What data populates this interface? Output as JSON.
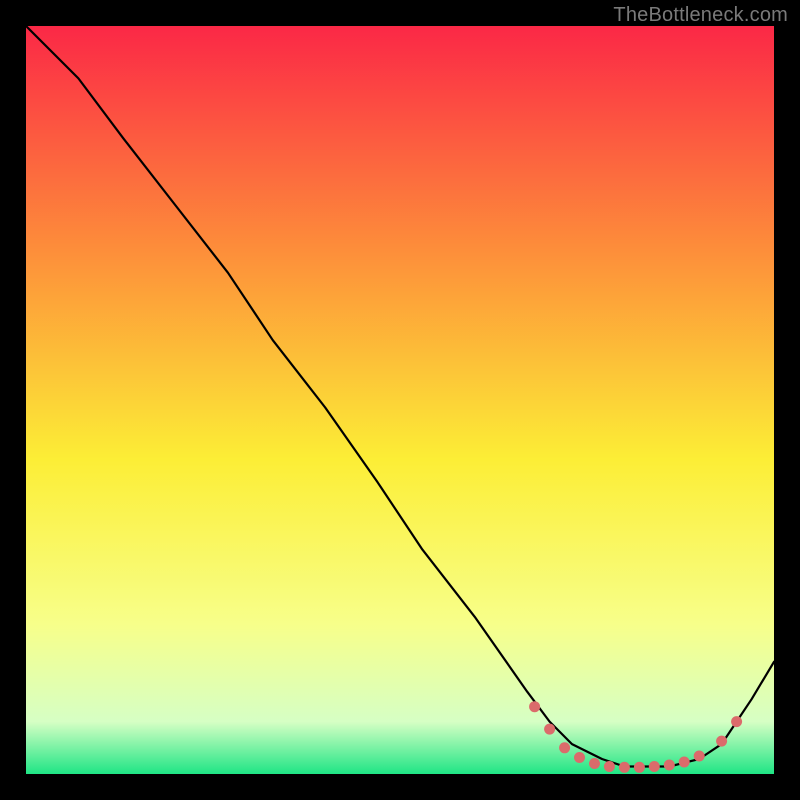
{
  "watermark": "TheBottleneck.com",
  "colors": {
    "gradient_top": "#fb2846",
    "gradient_mid_top": "#fd8e3a",
    "gradient_mid": "#fcee36",
    "gradient_mid_low": "#f7ff8a",
    "gradient_low": "#d6ffc4",
    "gradient_bottom": "#1fe585",
    "curve": "#000000",
    "dot": "#db6b6b",
    "background": "#000000"
  },
  "chart_data": {
    "type": "line",
    "title": "",
    "xlabel": "",
    "ylabel": "",
    "xlim": [
      0,
      100
    ],
    "ylim": [
      0,
      100
    ],
    "grid": false,
    "legend": false,
    "series": [
      {
        "name": "curve",
        "x": [
          0,
          7,
          13,
          20,
          27,
          33,
          40,
          47,
          53,
          60,
          67,
          70,
          73,
          77,
          80,
          83,
          86,
          90,
          93,
          95,
          97,
          100
        ],
        "y": [
          100,
          93,
          85,
          76,
          67,
          58,
          49,
          39,
          30,
          21,
          11,
          7,
          4,
          2,
          1,
          1,
          1,
          2,
          4,
          7,
          10,
          15
        ]
      }
    ],
    "highlight_points": {
      "name": "optimal-range",
      "x": [
        68,
        70,
        72,
        74,
        76,
        78,
        80,
        82,
        84,
        86,
        88,
        90,
        93,
        95
      ],
      "y": [
        9,
        6,
        3.5,
        2.2,
        1.4,
        1,
        0.9,
        0.9,
        1,
        1.2,
        1.6,
        2.4,
        4.4,
        7
      ]
    }
  }
}
